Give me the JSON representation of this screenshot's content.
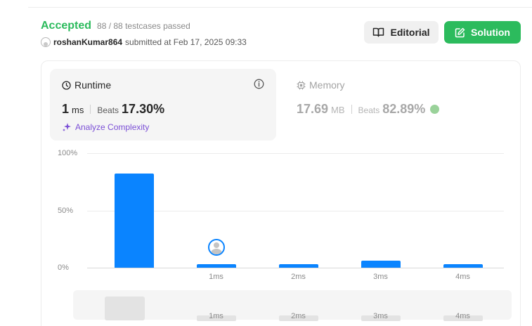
{
  "submission": {
    "status": "Accepted",
    "testcases": "88 / 88 testcases passed",
    "user": "roshanKumar864",
    "submitted_text": "submitted at Feb 17, 2025 09:33"
  },
  "buttons": {
    "editorial": "Editorial",
    "solution": "Solution"
  },
  "runtime": {
    "title": "Runtime",
    "value": "1",
    "unit": "ms",
    "beats_label": "Beats",
    "beats": "17.30%",
    "analyze": "Analyze Complexity"
  },
  "memory": {
    "title": "Memory",
    "value": "17.69",
    "unit": "MB",
    "beats_label": "Beats",
    "beats": "82.89%"
  },
  "colors": {
    "accepted": "#2cbb5d",
    "bar": "#0a84ff",
    "analyze": "#7b4fd6"
  },
  "chart_data": {
    "type": "bar",
    "y_ticks": [
      "100%",
      "50%",
      "0%"
    ],
    "ylim": [
      0,
      100
    ],
    "categories": [
      "",
      "1ms",
      "2ms",
      "3ms",
      "4ms"
    ],
    "values": [
      82,
      3,
      3,
      6,
      3
    ],
    "selected_category": "1ms",
    "grid": true
  },
  "scrubber": {
    "labels": [
      "1ms",
      "2ms",
      "3ms",
      "4ms"
    ]
  }
}
